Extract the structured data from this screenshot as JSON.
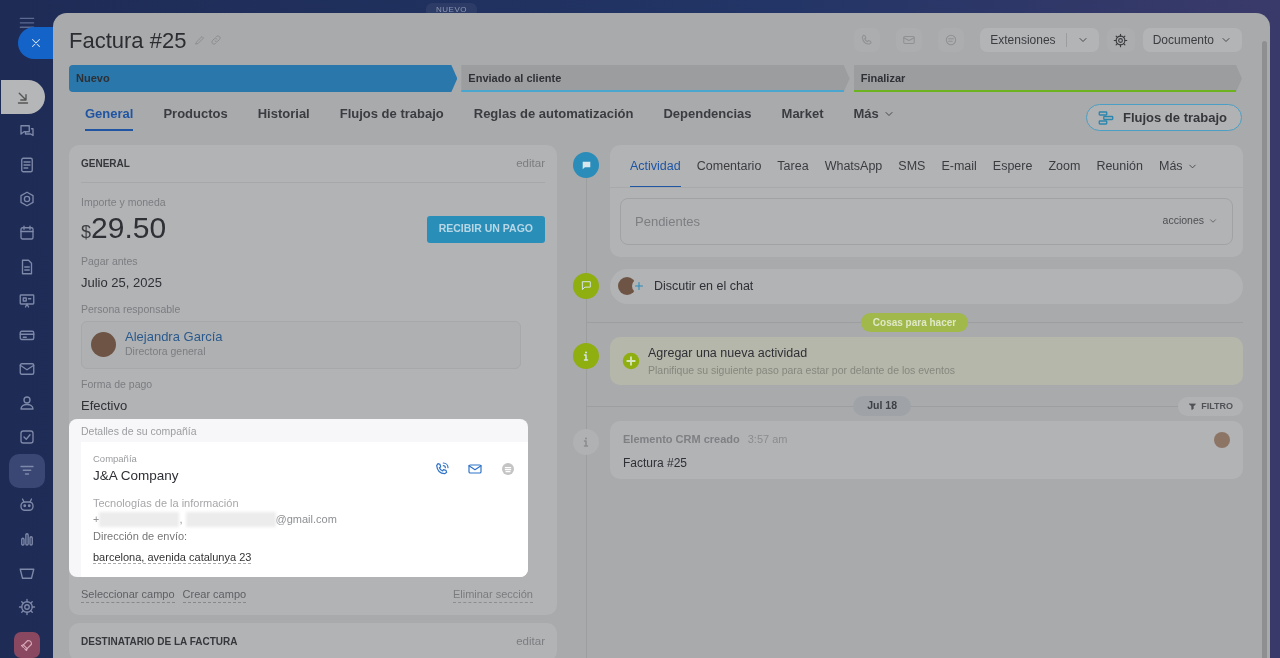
{
  "background_label": "NUEVO",
  "sidebar": {
    "items": [
      {
        "kind": "download",
        "selected": true
      },
      {
        "kind": "chat",
        "selected": false
      },
      {
        "kind": "list",
        "selected": false
      },
      {
        "kind": "hexagon",
        "selected": false
      },
      {
        "kind": "calendar",
        "selected": false
      },
      {
        "kind": "doc",
        "selected": false
      },
      {
        "kind": "board",
        "selected": false
      },
      {
        "kind": "card",
        "selected": false
      },
      {
        "kind": "mail",
        "selected": false
      },
      {
        "kind": "users",
        "selected": false
      },
      {
        "kind": "check",
        "selected": false
      },
      {
        "kind": "funnel",
        "selected": true
      },
      {
        "kind": "robot",
        "selected": false
      },
      {
        "kind": "chart",
        "selected": false
      },
      {
        "kind": "basket",
        "selected": false
      },
      {
        "kind": "gear",
        "selected": false
      }
    ]
  },
  "header": {
    "title": "Factura #25",
    "extensions": "Extensiones",
    "document": "Documento"
  },
  "stages": [
    {
      "label": "Nuevo",
      "selected": true,
      "color": "#2a77ab"
    },
    {
      "label": "Enviado al cliente",
      "selected": false,
      "color": "#4aa6cf"
    },
    {
      "label": "Finalizar",
      "selected": false,
      "color": "#6cb31f"
    }
  ],
  "tabs": [
    {
      "label": "General",
      "selected": true
    },
    {
      "label": "Productos",
      "selected": false
    },
    {
      "label": "Historial",
      "selected": false
    },
    {
      "label": "Flujos de trabajo",
      "selected": false
    },
    {
      "label": "Reglas de automatización",
      "selected": false
    },
    {
      "label": "Dependencias",
      "selected": false
    },
    {
      "label": "Market",
      "selected": false
    }
  ],
  "more_tab": "Más",
  "workflow_button": "Flujos de trabajo",
  "general_card": {
    "title": "GENERAL",
    "edit": "editar",
    "amount_label": "Importe y moneda",
    "currency": "$",
    "amount": "29.50",
    "pay_button": "RECIBIR UN PAGO",
    "due_label": "Pagar antes",
    "due": "Julio 25, 2025",
    "responsible_label": "Persona responsable",
    "person": {
      "name": "Alejandra García",
      "role": "Directora general"
    },
    "payment_label": "Forma de pago",
    "payment": "Efectivo",
    "company_section": {
      "title": "Detalles de su compañía",
      "company_label": "Compañía",
      "company": "J&A Company",
      "industry": "Tecnologías de la información",
      "phone_prefix": "+",
      "separator": ",",
      "email_suffix": "@gmail.com",
      "address_label": "Dirección de envío:",
      "address": "barcelona, avenida catalunya 23"
    },
    "links": [
      "Seleccionar campo",
      "Crear campo"
    ],
    "delete_link": "Eliminar sección"
  },
  "recipient_card": {
    "title": "DESTINATARIO DE LA FACTURA",
    "edit": "editar"
  },
  "activity": {
    "tabs": [
      {
        "label": "Actividad",
        "selected": true
      },
      {
        "label": "Comentario",
        "selected": false
      },
      {
        "label": "Tarea",
        "selected": false
      },
      {
        "label": "WhatsApp",
        "selected": false
      },
      {
        "label": "SMS",
        "selected": false
      },
      {
        "label": "E-mail",
        "selected": false
      },
      {
        "label": "Espere",
        "selected": false
      },
      {
        "label": "Zoom",
        "selected": false
      },
      {
        "label": "Reunión",
        "selected": false
      }
    ],
    "more": "Más",
    "pending": "Pendientes",
    "actions": "acciones"
  },
  "chat": "Discutir en el chat",
  "todo_badge": "Cosas para hacer",
  "new_activity": {
    "title": "Agregar una nueva actividad",
    "subtitle": "Planifique su siguiente paso para estar por delante de los eventos"
  },
  "date": "Jul 18",
  "filter": "FILTRO",
  "event": {
    "title": "Elemento CRM creado",
    "time": "3:57 am",
    "text": "Factura #25"
  }
}
